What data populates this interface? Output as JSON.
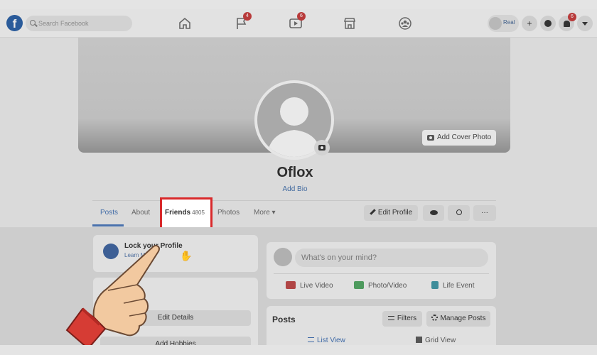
{
  "topnav": {
    "logo": "f",
    "search_placeholder": "Search Facebook",
    "badges": {
      "pages": "4",
      "watch": "6",
      "notifications": "6"
    },
    "user_name": "Real"
  },
  "profile": {
    "name": "Oflox",
    "add_bio": "Add Bio",
    "add_cover_photo": "Add Cover Photo"
  },
  "tabs": {
    "posts": "Posts",
    "about": "About",
    "friends": "Friends",
    "friends_count": "4805",
    "photos": "Photos",
    "more": "More ▾"
  },
  "actions": {
    "edit_profile": "Edit Profile",
    "view_icon": "eye-icon",
    "search_icon": "search-icon",
    "more": "···"
  },
  "lock_card": {
    "title": "Lock your Profile",
    "subtitle": "Learn More"
  },
  "intro": {
    "edit_details": "Edit Details",
    "add_hobbies": "Add Hobbies"
  },
  "composer": {
    "placeholder": "What's on your mind?",
    "live_video": "Live Video",
    "photo_video": "Photo/Video",
    "life_event": "Life Event"
  },
  "posts_card": {
    "title": "Posts",
    "filters": "Filters",
    "manage_posts": "Manage Posts",
    "list_view": "List View",
    "grid_view": "Grid View"
  },
  "colors": {
    "highlight": "#d8292b",
    "accent": "#3f6aa6"
  }
}
